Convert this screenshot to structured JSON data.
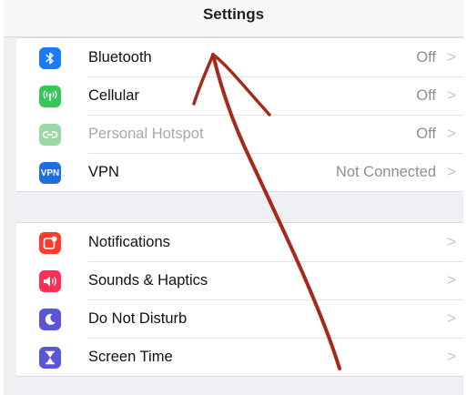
{
  "header": {
    "title": "Settings"
  },
  "group1": {
    "rows": [
      {
        "label": "Bluetooth",
        "value": "Off",
        "icon": "bluetooth-icon",
        "icon_color": "#1a7cf5",
        "enabled": true
      },
      {
        "label": "Cellular",
        "value": "Off",
        "icon": "cellular-antenna-icon",
        "icon_color": "#34c759",
        "enabled": true
      },
      {
        "label": "Personal Hotspot",
        "value": "Off",
        "icon": "personal-hotspot-icon",
        "icon_color": "#9ad8a6",
        "enabled": false
      },
      {
        "label": "VPN",
        "value": "Not Connected",
        "icon": "vpn-icon",
        "icon_color": "#1a6ee0",
        "enabled": true,
        "icon_text": "VPN"
      }
    ]
  },
  "group2": {
    "rows": [
      {
        "label": "Notifications",
        "value": "",
        "icon": "notifications-icon",
        "icon_color": "#ff3b30"
      },
      {
        "label": "Sounds & Haptics",
        "value": "",
        "icon": "speaker-icon",
        "icon_color": "#ff2d55"
      },
      {
        "label": "Do Not Disturb",
        "value": "",
        "icon": "moon-icon",
        "icon_color": "#5856d6"
      },
      {
        "label": "Screen Time",
        "value": "",
        "icon": "hourglass-icon",
        "icon_color": "#5856d6"
      }
    ]
  },
  "annotation": {
    "color": "#a52a1c",
    "shape": "hand-drawn-arrow-pointing-to-bluetooth"
  },
  "chevron_glyph": ">"
}
